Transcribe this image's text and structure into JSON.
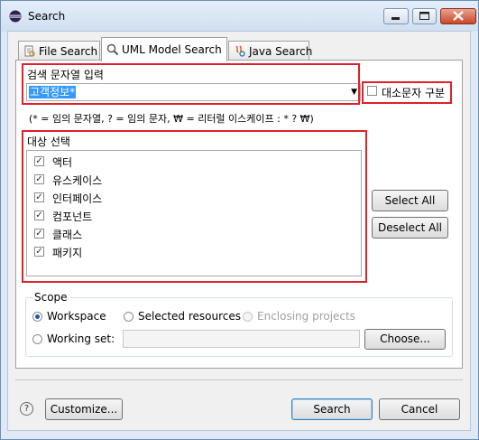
{
  "window": {
    "title": "Search"
  },
  "tabs": [
    {
      "label": "File Search",
      "icon": "file-search-icon"
    },
    {
      "label": "UML Model Search",
      "icon": "uml-model-icon",
      "active": true
    },
    {
      "label": "Java Search",
      "icon": "java-search-icon"
    }
  ],
  "search": {
    "label": "검색 문자열 입력",
    "value": "고객정보*",
    "case_label": "대소문자 구분",
    "case_checked": false,
    "hint": "(* = 임의 문자열, ? = 임의 문자, ₩ = 리터럴 이스케이프 : * ? ₩)"
  },
  "targets": {
    "label": "대상 선택",
    "items": [
      {
        "label": "액터",
        "checked": true
      },
      {
        "label": "유스케이스",
        "checked": true
      },
      {
        "label": "인터페이스",
        "checked": true
      },
      {
        "label": "컴포넌트",
        "checked": true
      },
      {
        "label": "클래스",
        "checked": true
      },
      {
        "label": "패키지",
        "checked": true
      }
    ],
    "select_all": "Select All",
    "deselect_all": "Deselect All"
  },
  "scope": {
    "label": "Scope",
    "workspace": "Workspace",
    "selected_resources": "Selected resources",
    "enclosing_projects": "Enclosing projects",
    "working_set": "Working set:",
    "choose": "Choose..."
  },
  "footer": {
    "help": "?",
    "customize": "Customize...",
    "search": "Search",
    "cancel": "Cancel"
  },
  "colors": {
    "highlight": "#e0202a",
    "selection": "#3399ff"
  }
}
